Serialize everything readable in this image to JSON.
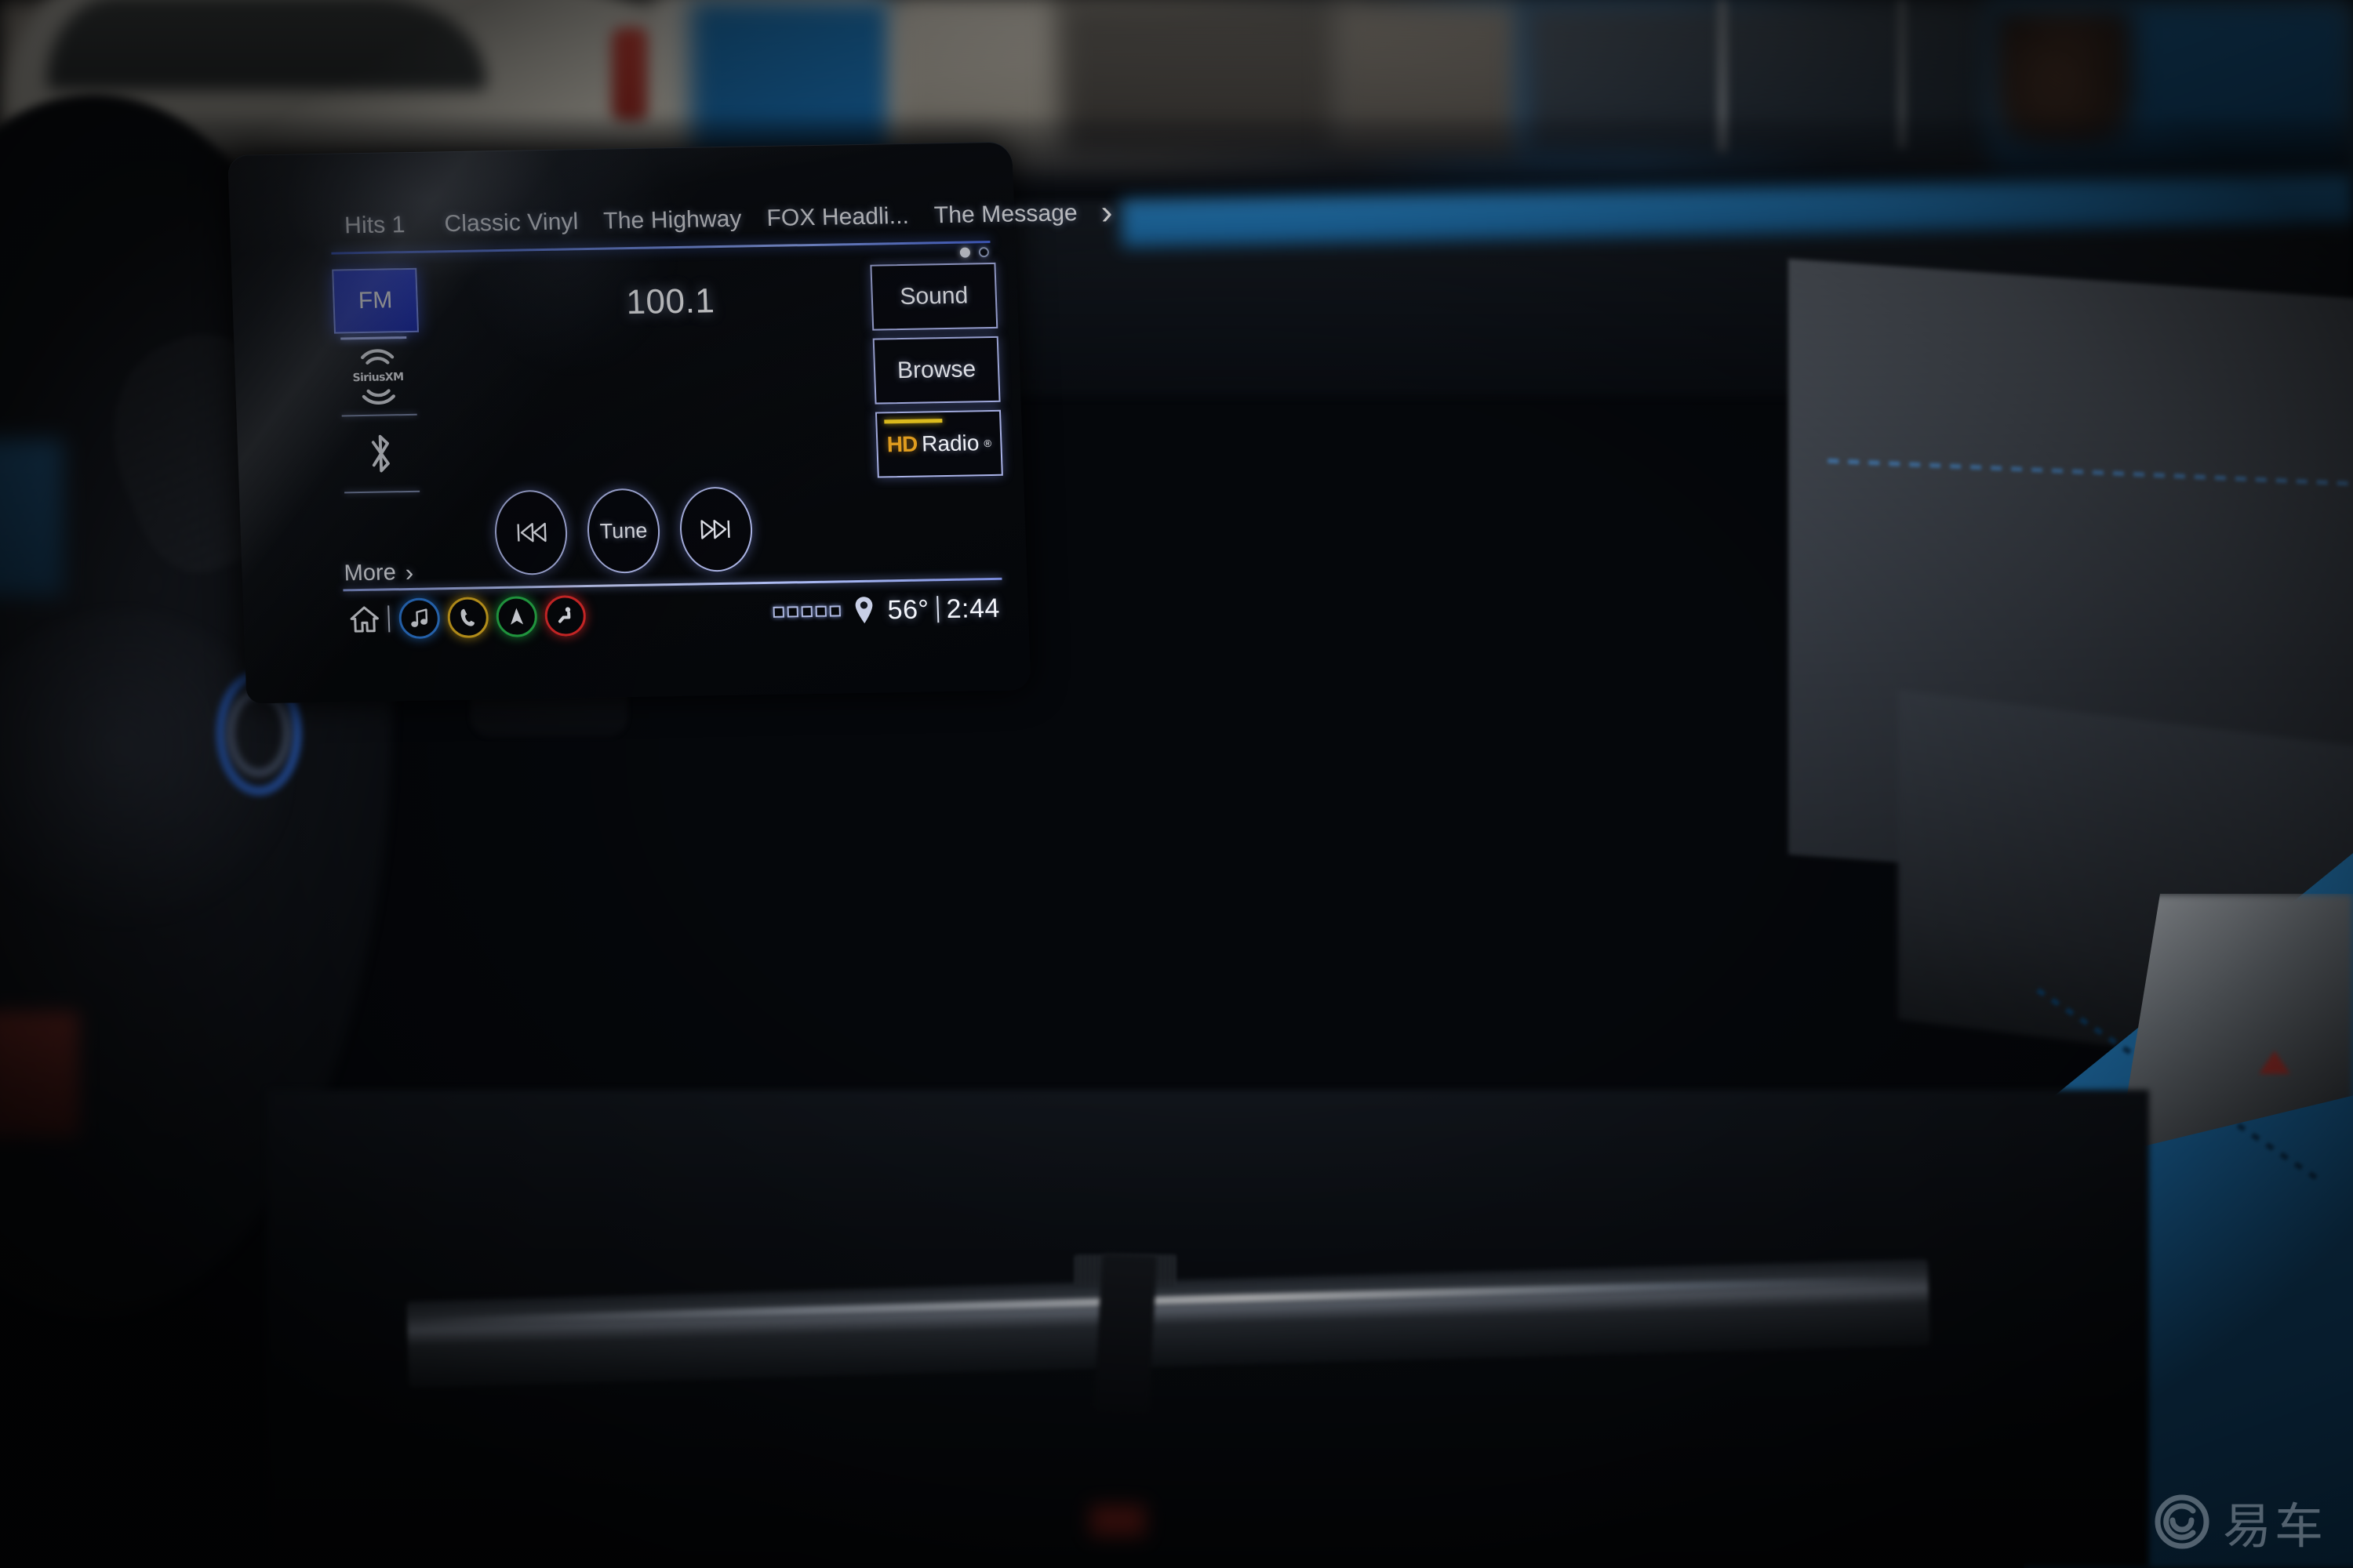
{
  "screen": {
    "presets": {
      "items": [
        {
          "label": "Hits 1"
        },
        {
          "label": "Classic Vinyl"
        },
        {
          "label": "The Highway"
        },
        {
          "label": "FOX Headli..."
        },
        {
          "label": "The Message"
        }
      ],
      "next_icon": "chevron-right-icon",
      "page_dots": [
        "filled",
        "hollow"
      ]
    },
    "sources": {
      "fm_label": "FM",
      "siriusxm_label": "SiriusXM",
      "bluetooth_icon": "bluetooth-icon",
      "more_label": "More",
      "more_chevron": "chevron-right-icon"
    },
    "now_playing": {
      "frequency": "100.1"
    },
    "actions": {
      "sound_label": "Sound",
      "browse_label": "Browse",
      "hd_radio": {
        "mark": "HD",
        "word": "Radio",
        "registered": "®"
      }
    },
    "transport": {
      "previous_icon": "skip-previous-icon",
      "tune_label": "Tune",
      "next_icon": "skip-next-icon"
    },
    "bottom_bar": {
      "home_icon": "home-icon",
      "apps": [
        {
          "name": "audio",
          "icon": "music-note-icon",
          "color": "#2f7fe0"
        },
        {
          "name": "phone",
          "icon": "phone-icon",
          "color": "#e0b020"
        },
        {
          "name": "navigation",
          "icon": "navigation-arrow-icon",
          "color": "#26b34a"
        },
        {
          "name": "vehicle",
          "icon": "seat-person-icon",
          "color": "#e02a2a"
        }
      ],
      "status": {
        "signal_icon": "signal-bars-icon",
        "signal_bars": 5,
        "location_icon": "location-pin-icon",
        "temperature": "56°",
        "divider": "|",
        "time": "2:44"
      }
    },
    "colors": {
      "accent_blue": "#1f36d8",
      "outline": "#aab3e8",
      "hd_gold": "#e8a21f",
      "rule_blue": "#6f8ef5"
    }
  },
  "hardware": {
    "volume_knob": "volume-knob",
    "home_hard_button_icon": "home-icon"
  },
  "watermark": {
    "text": "易车",
    "mark": "yiche-logo-icon"
  }
}
